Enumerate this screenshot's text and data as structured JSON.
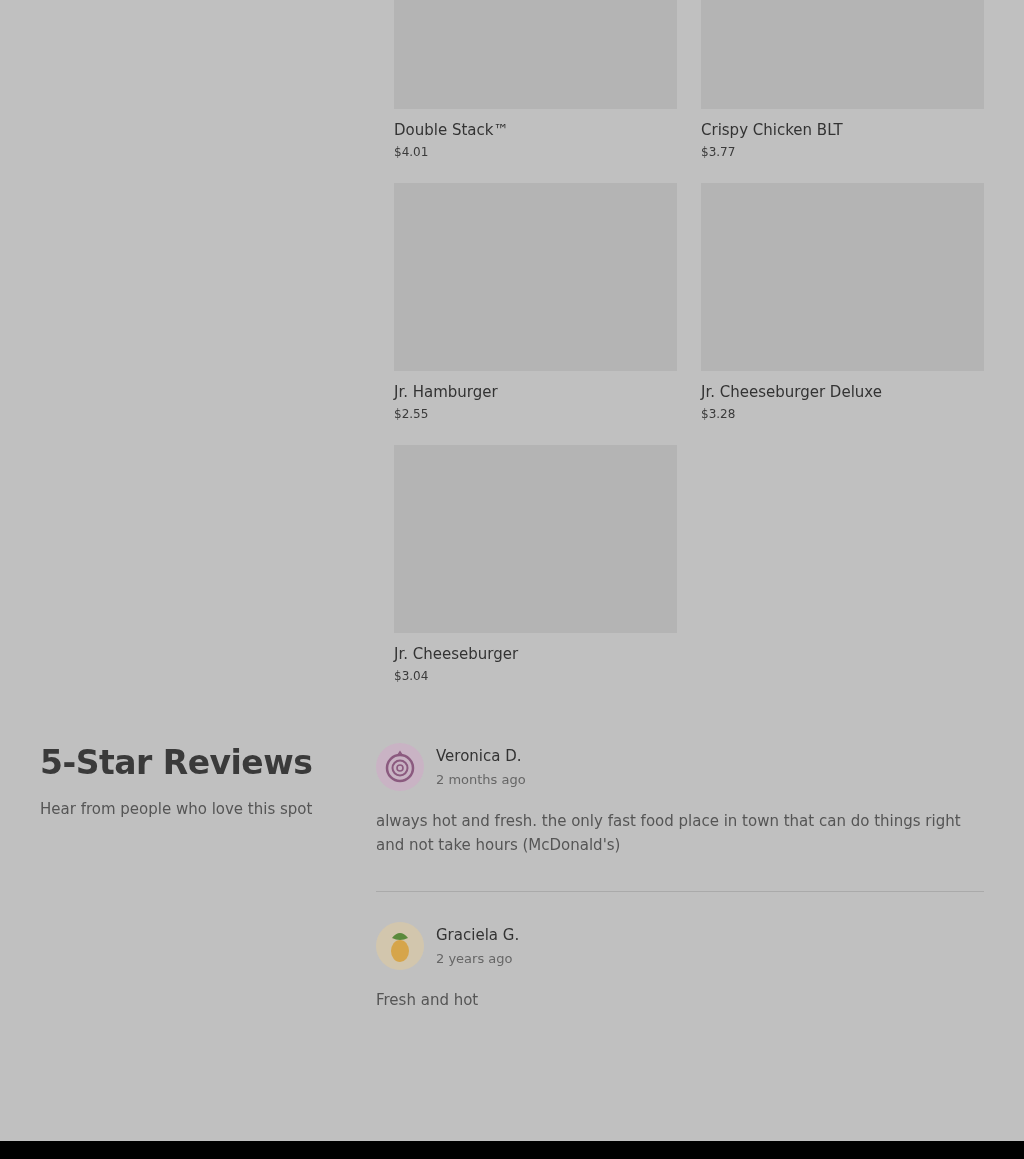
{
  "menu_items": [
    {
      "name": "Double Stack™",
      "price": "$4.01"
    },
    {
      "name": "Crispy Chicken BLT",
      "price": "$3.77"
    },
    {
      "name": "Jr. Hamburger",
      "price": "$2.55"
    },
    {
      "name": "Jr. Cheeseburger Deluxe",
      "price": "$3.28"
    },
    {
      "name": "Jr. Cheeseburger",
      "price": "$3.04"
    }
  ],
  "reviews_section": {
    "title": "5-Star Reviews",
    "subtitle": "Hear from people who love this spot"
  },
  "reviews": [
    {
      "kind": "onion",
      "author": "Veronica D.",
      "time": "2 months ago",
      "text": "always hot and fresh. the only fast food place in town that can do things right and not take hours (McDonald's)"
    },
    {
      "kind": "pineapple",
      "author": "Graciela G.",
      "time": "2 years ago",
      "text": "Fresh and hot"
    }
  ]
}
